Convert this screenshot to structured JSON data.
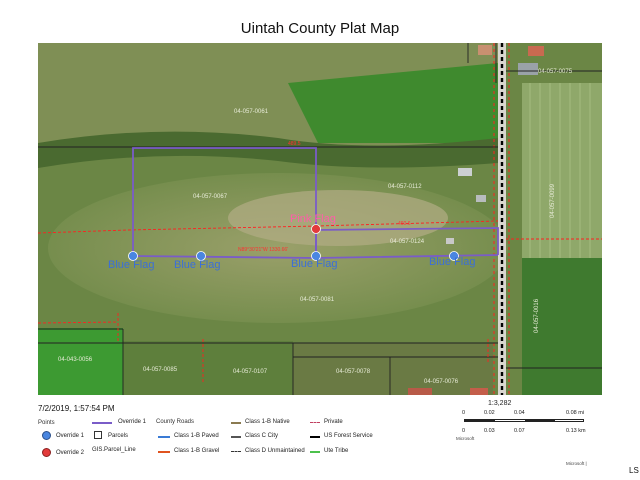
{
  "map": {
    "title": "Uintah County Plat Map",
    "print_date": "7/2/2019, 1:57:54 PM",
    "scale": {
      "ratio": "1:3,282",
      "mi_ticks": [
        "0",
        "0.02",
        "0.04",
        "0.08 mi"
      ],
      "km_ticks": [
        "0",
        "0.03",
        "0.07",
        "0.13 km"
      ],
      "provider": "Microsoft"
    },
    "credit": "Microsoft |",
    "corner_text": "LS",
    "flags": [
      {
        "label": "Blue Flag",
        "color": "#3b6fd8"
      },
      {
        "label": "Blue Flag",
        "color": "#3b6fd8"
      },
      {
        "label": "Blue Flag",
        "color": "#3b6fd8"
      },
      {
        "label": "Blue Flag",
        "color": "#3b6fd8"
      },
      {
        "label": "Pink Flag",
        "color": "#ff5ea8"
      }
    ],
    "parcels": [
      "04-057-0061",
      "04-057-0067",
      "04-057-0112",
      "04-057-0124",
      "04-057-0081",
      "04-057-0075",
      "04-057-0099",
      "04-057-0085",
      "04-057-0107",
      "04-057-0078",
      "04-057-0076",
      "04-043-0056",
      "04-057-0016"
    ],
    "dimensions": {
      "d1": "489.5",
      "d2": "460.6",
      "d3": "N89°30'21\"W 1330.66'"
    },
    "colors": {
      "override": "#7a5cc8",
      "parcel_line": "#222222",
      "gis_parcel": "#ff2020",
      "county_road_paved": "#3a7bd5",
      "county_road_gravel": "#e0531f",
      "forest_service": "#000000",
      "ute_tribe": "#4cc14c"
    }
  },
  "legend": {
    "points_header": "Points",
    "override1_point": "Override 1",
    "override2_point": "Override 2",
    "override1_line": "Override 1",
    "parcels": "Parcels",
    "gis_parcel_line": "GIS.Parcel_Line",
    "county_roads_header": "County Roads",
    "class_1b_paved": "Class 1-B Paved",
    "class_1b_gravel": "Class 1-B Gravel",
    "class_1b_native": "Class 1-B Native",
    "class_c_city": "Class C City",
    "class_d_unmaintained": "Class D Unmaintained",
    "private": "Private",
    "us_forest_service": "US Forest Service",
    "ute_tribe": "Ute Tribe"
  }
}
